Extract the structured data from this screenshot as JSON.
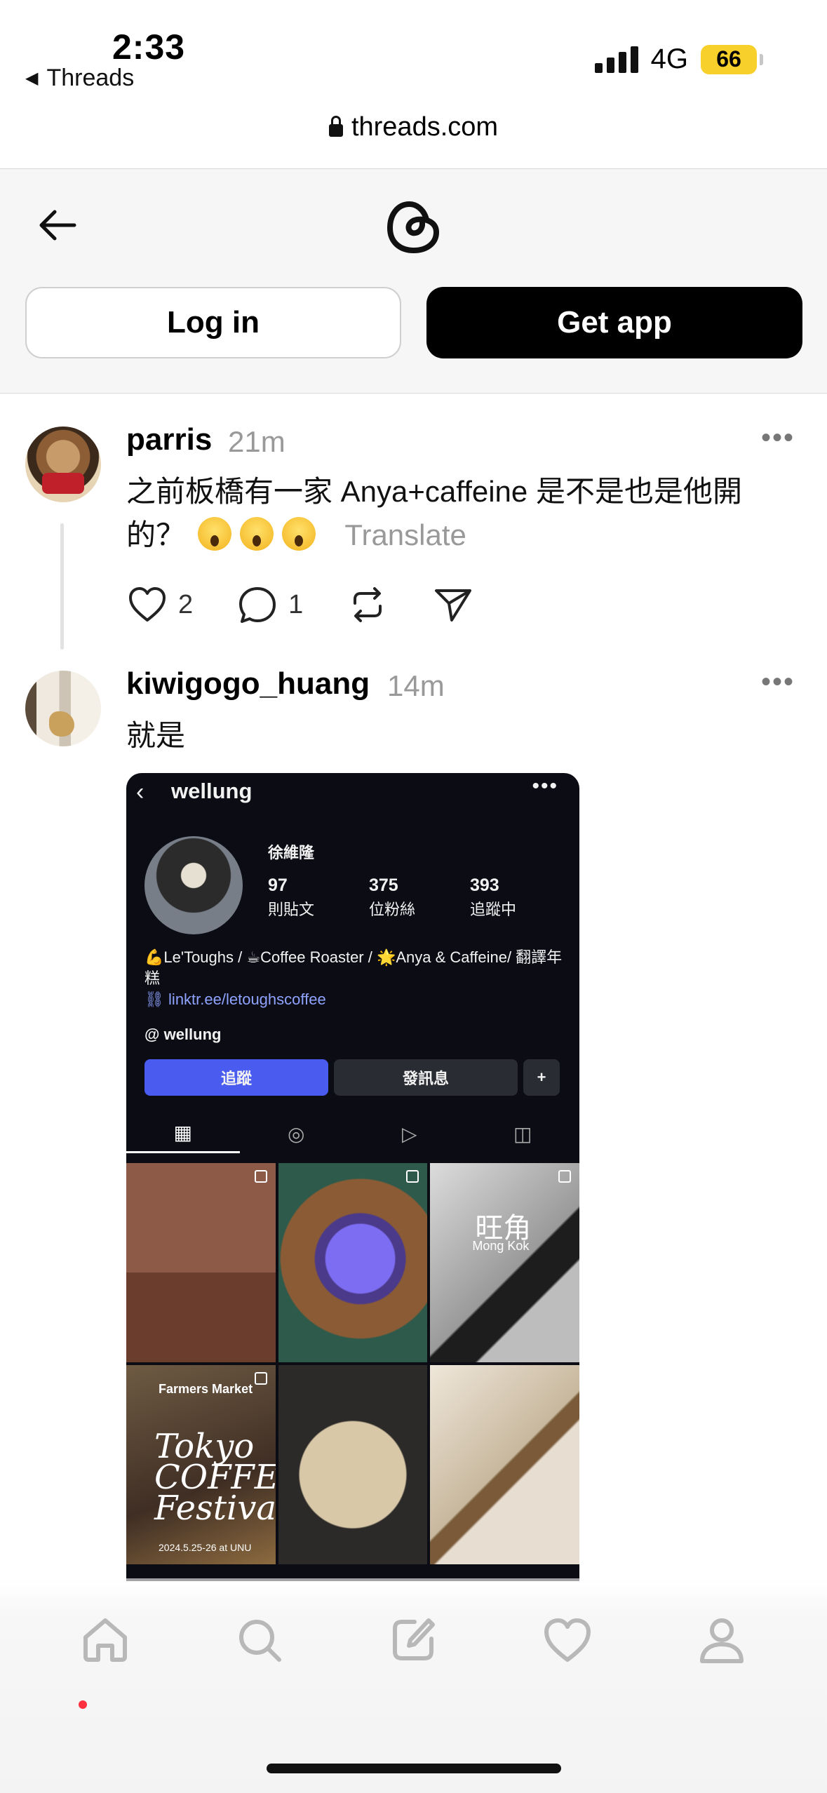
{
  "status_bar": {
    "time": "2:33",
    "back_app": "Threads",
    "network": "4G",
    "battery": "66",
    "battery_color": "#f7d02c"
  },
  "browser": {
    "url": "threads.com"
  },
  "header": {
    "login_label": "Log in",
    "getapp_label": "Get app"
  },
  "posts": [
    {
      "username": "parris",
      "time": "21m",
      "text": "之前板橋有一家 Anya+caffeine 是不是也是他開的？",
      "translate": "Translate",
      "likes": "2",
      "replies": "1"
    },
    {
      "username": "kiwigogo_huang",
      "time": "14m",
      "text": "就是"
    }
  ],
  "embedded_profile": {
    "username": "wellung",
    "name": "徐維隆",
    "posts_count": "97",
    "posts_label": "則貼文",
    "followers_count": "375",
    "followers_label": "位粉絲",
    "following_count": "393",
    "following_label": "追蹤中",
    "bio": "💪Le'Toughs / ☕Coffee Roaster / 🌟Anya & Caffeine/ 翻譯年糕",
    "link": "linktr.ee/letoughscoffee",
    "threads_handle": "wellung",
    "follow_label": "追蹤",
    "message_label": "發訊息",
    "grid_text": {
      "mongkok_cn": "旺角",
      "mongkok_en": "Mong Kok",
      "farmers_market": "Farmers Market",
      "festival": "Tokyo COFFEE Festival",
      "festival_date": "2024.5.25-26 at UNU"
    }
  },
  "colors": {
    "accent_red": "#ff3040",
    "follow_blue": "#4a5cf0"
  },
  "nav_icons": [
    "home-icon",
    "search-icon",
    "compose-icon",
    "heart-icon",
    "profile-icon"
  ]
}
